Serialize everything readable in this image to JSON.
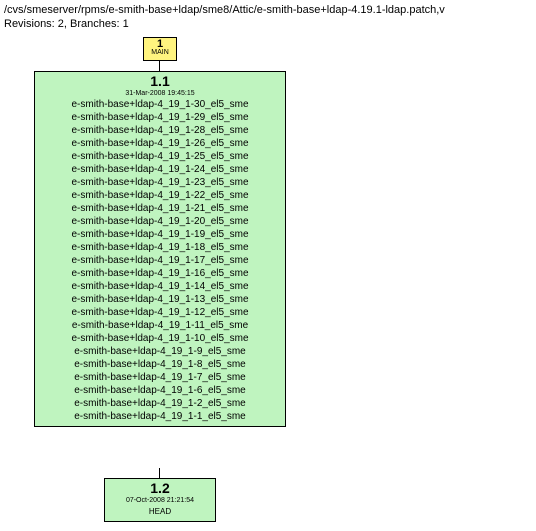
{
  "header": {
    "path": "/cvs/smeserver/rpms/e-smith-base+ldap/sme8/Attic/e-smith-base+ldap-4.19.1-ldap.patch,v",
    "meta": "Revisions: 2, Branches: 1"
  },
  "branch": {
    "number": "1",
    "label": "MAIN"
  },
  "rev_1_1": {
    "title": "1.1",
    "date": "31-Mar-2008 19:45:15",
    "tags": "e-smith-base+ldap-4_19_1-30_el5_sme\ne-smith-base+ldap-4_19_1-29_el5_sme\ne-smith-base+ldap-4_19_1-28_el5_sme\ne-smith-base+ldap-4_19_1-26_el5_sme\ne-smith-base+ldap-4_19_1-25_el5_sme\ne-smith-base+ldap-4_19_1-24_el5_sme\ne-smith-base+ldap-4_19_1-23_el5_sme\ne-smith-base+ldap-4_19_1-22_el5_sme\ne-smith-base+ldap-4_19_1-21_el5_sme\ne-smith-base+ldap-4_19_1-20_el5_sme\ne-smith-base+ldap-4_19_1-19_el5_sme\ne-smith-base+ldap-4_19_1-18_el5_sme\ne-smith-base+ldap-4_19_1-17_el5_sme\ne-smith-base+ldap-4_19_1-16_el5_sme\ne-smith-base+ldap-4_19_1-14_el5_sme\ne-smith-base+ldap-4_19_1-13_el5_sme\ne-smith-base+ldap-4_19_1-12_el5_sme\ne-smith-base+ldap-4_19_1-11_el5_sme\ne-smith-base+ldap-4_19_1-10_el5_sme\ne-smith-base+ldap-4_19_1-9_el5_sme\ne-smith-base+ldap-4_19_1-8_el5_sme\ne-smith-base+ldap-4_19_1-7_el5_sme\ne-smith-base+ldap-4_19_1-6_el5_sme\ne-smith-base+ldap-4_19_1-2_el5_sme\ne-smith-base+ldap-4_19_1-1_el5_sme"
  },
  "rev_1_2": {
    "title": "1.2",
    "date": "07-Oct-2008 21:21:54",
    "tags": "HEAD"
  }
}
